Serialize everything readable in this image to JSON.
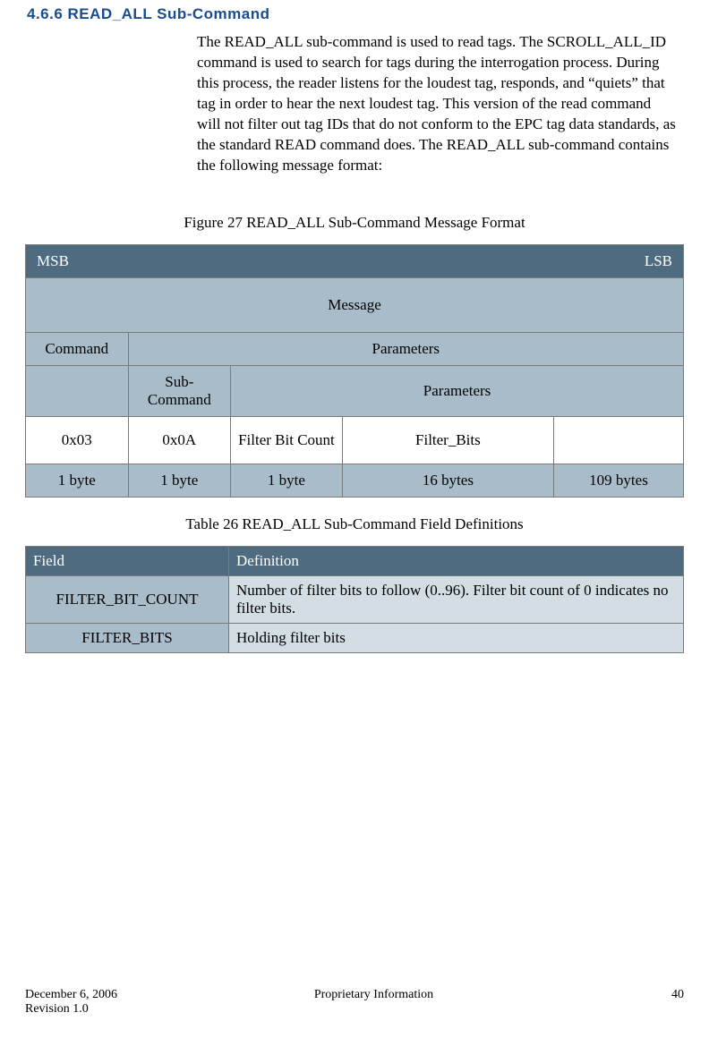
{
  "heading": "4.6.6 READ_ALL Sub-Command",
  "paragraph": "The READ_ALL sub-command is used to read tags.  The SCROLL_ALL_ID command is used to search for tags during the interrogation process.  During this process, the reader listens for the loudest tag, responds, and “quiets” that tag in order to hear the next loudest tag.  This version of the read command will not filter out tag IDs that do not conform to the EPC tag data standards, as the standard READ command does.  The READ_ALL sub-command contains the following message format:",
  "figure_caption": "Figure 27 READ_ALL Sub-Command Message Format",
  "table1": {
    "msb": "MSB",
    "lsb": "LSB",
    "message": "Message",
    "command": "Command",
    "parameters": "Parameters",
    "subcommand": "Sub-Command",
    "parameters2": "Parameters",
    "row_vals": [
      "0x03",
      "0x0A",
      "Filter Bit Count",
      "Filter_Bits",
      ""
    ],
    "row_sizes": [
      "1 byte",
      "1 byte",
      "1 byte",
      "16 bytes",
      "109 bytes"
    ]
  },
  "table2_caption": "Table 26 READ_ALL Sub-Command Field Definitions",
  "table2": {
    "header": [
      "Field",
      "Definition"
    ],
    "rows": [
      {
        "field": "FILTER_BIT_COUNT",
        "def": "Number of filter bits to follow (0..96).  Filter bit count of 0 indicates no filter bits."
      },
      {
        "field": "FILTER_BITS",
        "def": "Holding filter bits"
      }
    ]
  },
  "footer": {
    "date": "December 6, 2006",
    "revision": "Revision 1.0",
    "center": "Proprietary Information",
    "page": "40"
  }
}
